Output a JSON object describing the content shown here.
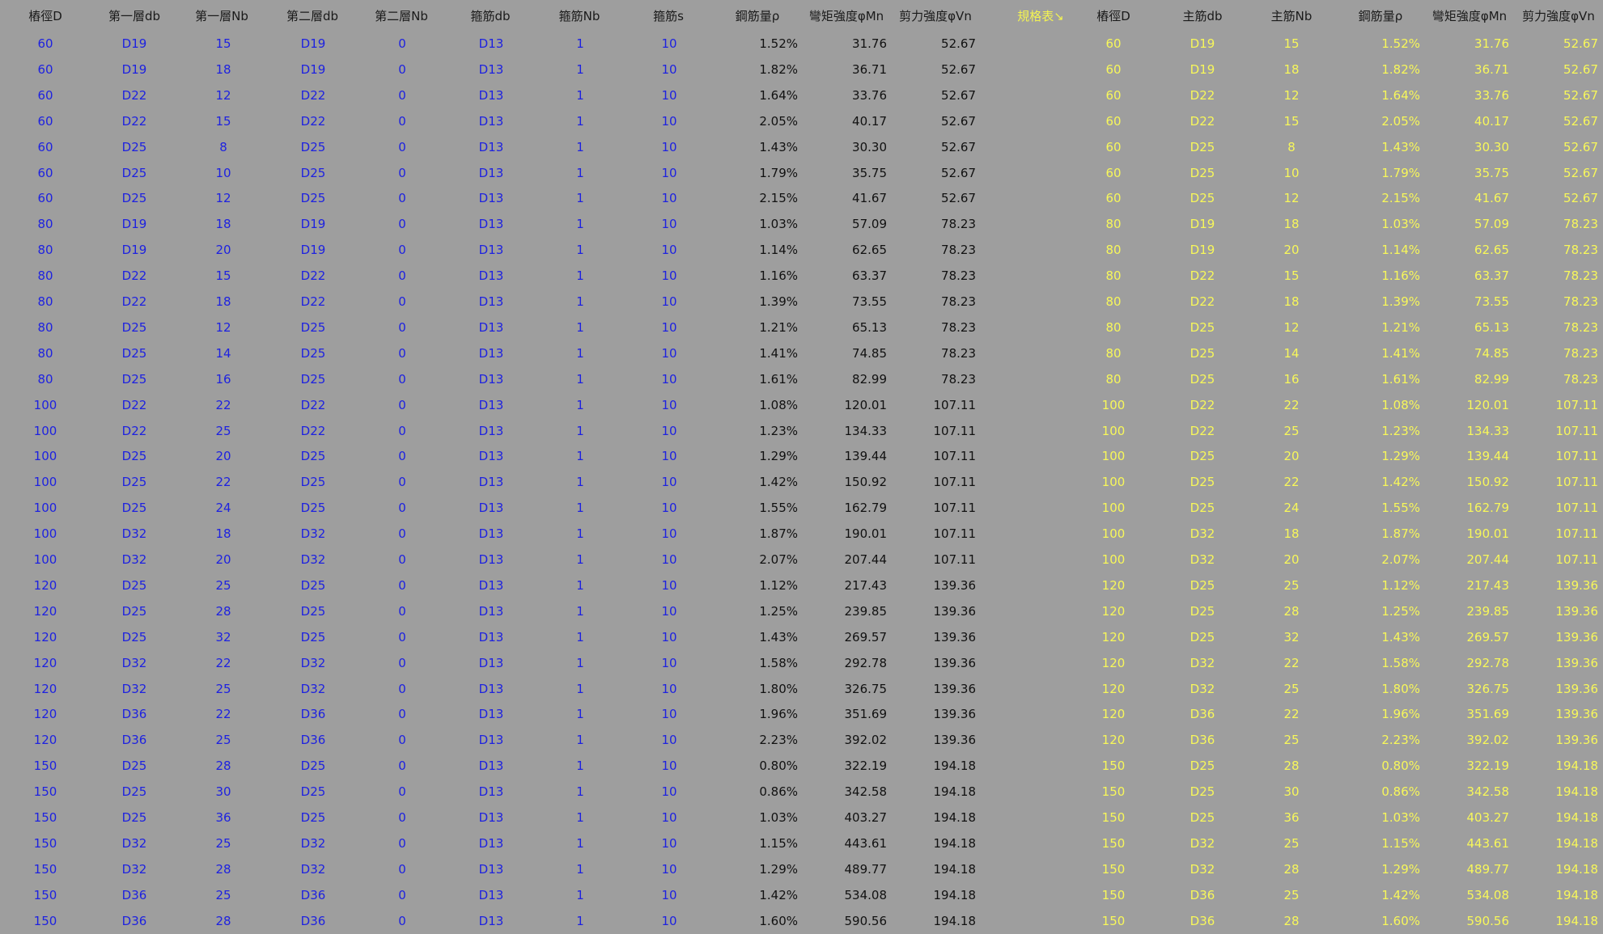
{
  "left_headers": [
    "樁徑D",
    "第一層db",
    "第一層Nb",
    "第二層db",
    "第二層Nb",
    "箍筋db",
    "箍筋Nb",
    "箍筋s",
    "鋼筋量ρ",
    "彎矩強度φMn",
    "剪力強度φVn"
  ],
  "spec_label": "規格表↘",
  "right_headers": [
    "樁徑D",
    "主筋db",
    "主筋Nb",
    "鋼筋量ρ",
    "彎矩強度φMn",
    "剪力強度φVn"
  ],
  "colors": {
    "background": "#9e9e9e",
    "input_blue": "#1e22e0",
    "output_black": "#111111",
    "spec_yellow": "#f7f75a"
  },
  "rows": [
    [
      "60",
      "D19",
      "15",
      "D19",
      "0",
      "D13",
      "1",
      "10",
      "1.52%",
      "31.76",
      "52.67"
    ],
    [
      "60",
      "D19",
      "18",
      "D19",
      "0",
      "D13",
      "1",
      "10",
      "1.82%",
      "36.71",
      "52.67"
    ],
    [
      "60",
      "D22",
      "12",
      "D22",
      "0",
      "D13",
      "1",
      "10",
      "1.64%",
      "33.76",
      "52.67"
    ],
    [
      "60",
      "D22",
      "15",
      "D22",
      "0",
      "D13",
      "1",
      "10",
      "2.05%",
      "40.17",
      "52.67"
    ],
    [
      "60",
      "D25",
      "8",
      "D25",
      "0",
      "D13",
      "1",
      "10",
      "1.43%",
      "30.30",
      "52.67"
    ],
    [
      "60",
      "D25",
      "10",
      "D25",
      "0",
      "D13",
      "1",
      "10",
      "1.79%",
      "35.75",
      "52.67"
    ],
    [
      "60",
      "D25",
      "12",
      "D25",
      "0",
      "D13",
      "1",
      "10",
      "2.15%",
      "41.67",
      "52.67"
    ],
    [
      "80",
      "D19",
      "18",
      "D19",
      "0",
      "D13",
      "1",
      "10",
      "1.03%",
      "57.09",
      "78.23"
    ],
    [
      "80",
      "D19",
      "20",
      "D19",
      "0",
      "D13",
      "1",
      "10",
      "1.14%",
      "62.65",
      "78.23"
    ],
    [
      "80",
      "D22",
      "15",
      "D22",
      "0",
      "D13",
      "1",
      "10",
      "1.16%",
      "63.37",
      "78.23"
    ],
    [
      "80",
      "D22",
      "18",
      "D22",
      "0",
      "D13",
      "1",
      "10",
      "1.39%",
      "73.55",
      "78.23"
    ],
    [
      "80",
      "D25",
      "12",
      "D25",
      "0",
      "D13",
      "1",
      "10",
      "1.21%",
      "65.13",
      "78.23"
    ],
    [
      "80",
      "D25",
      "14",
      "D25",
      "0",
      "D13",
      "1",
      "10",
      "1.41%",
      "74.85",
      "78.23"
    ],
    [
      "80",
      "D25",
      "16",
      "D25",
      "0",
      "D13",
      "1",
      "10",
      "1.61%",
      "82.99",
      "78.23"
    ],
    [
      "100",
      "D22",
      "22",
      "D22",
      "0",
      "D13",
      "1",
      "10",
      "1.08%",
      "120.01",
      "107.11"
    ],
    [
      "100",
      "D22",
      "25",
      "D22",
      "0",
      "D13",
      "1",
      "10",
      "1.23%",
      "134.33",
      "107.11"
    ],
    [
      "100",
      "D25",
      "20",
      "D25",
      "0",
      "D13",
      "1",
      "10",
      "1.29%",
      "139.44",
      "107.11"
    ],
    [
      "100",
      "D25",
      "22",
      "D25",
      "0",
      "D13",
      "1",
      "10",
      "1.42%",
      "150.92",
      "107.11"
    ],
    [
      "100",
      "D25",
      "24",
      "D25",
      "0",
      "D13",
      "1",
      "10",
      "1.55%",
      "162.79",
      "107.11"
    ],
    [
      "100",
      "D32",
      "18",
      "D32",
      "0",
      "D13",
      "1",
      "10",
      "1.87%",
      "190.01",
      "107.11"
    ],
    [
      "100",
      "D32",
      "20",
      "D32",
      "0",
      "D13",
      "1",
      "10",
      "2.07%",
      "207.44",
      "107.11"
    ],
    [
      "120",
      "D25",
      "25",
      "D25",
      "0",
      "D13",
      "1",
      "10",
      "1.12%",
      "217.43",
      "139.36"
    ],
    [
      "120",
      "D25",
      "28",
      "D25",
      "0",
      "D13",
      "1",
      "10",
      "1.25%",
      "239.85",
      "139.36"
    ],
    [
      "120",
      "D25",
      "32",
      "D25",
      "0",
      "D13",
      "1",
      "10",
      "1.43%",
      "269.57",
      "139.36"
    ],
    [
      "120",
      "D32",
      "22",
      "D32",
      "0",
      "D13",
      "1",
      "10",
      "1.58%",
      "292.78",
      "139.36"
    ],
    [
      "120",
      "D32",
      "25",
      "D32",
      "0",
      "D13",
      "1",
      "10",
      "1.80%",
      "326.75",
      "139.36"
    ],
    [
      "120",
      "D36",
      "22",
      "D36",
      "0",
      "D13",
      "1",
      "10",
      "1.96%",
      "351.69",
      "139.36"
    ],
    [
      "120",
      "D36",
      "25",
      "D36",
      "0",
      "D13",
      "1",
      "10",
      "2.23%",
      "392.02",
      "139.36"
    ],
    [
      "150",
      "D25",
      "28",
      "D25",
      "0",
      "D13",
      "1",
      "10",
      "0.80%",
      "322.19",
      "194.18"
    ],
    [
      "150",
      "D25",
      "30",
      "D25",
      "0",
      "D13",
      "1",
      "10",
      "0.86%",
      "342.58",
      "194.18"
    ],
    [
      "150",
      "D25",
      "36",
      "D25",
      "0",
      "D13",
      "1",
      "10",
      "1.03%",
      "403.27",
      "194.18"
    ],
    [
      "150",
      "D32",
      "25",
      "D32",
      "0",
      "D13",
      "1",
      "10",
      "1.15%",
      "443.61",
      "194.18"
    ],
    [
      "150",
      "D32",
      "28",
      "D32",
      "0",
      "D13",
      "1",
      "10",
      "1.29%",
      "489.77",
      "194.18"
    ],
    [
      "150",
      "D36",
      "25",
      "D36",
      "0",
      "D13",
      "1",
      "10",
      "1.42%",
      "534.08",
      "194.18"
    ],
    [
      "150",
      "D36",
      "28",
      "D36",
      "0",
      "D13",
      "1",
      "10",
      "1.60%",
      "590.56",
      "194.18"
    ]
  ]
}
